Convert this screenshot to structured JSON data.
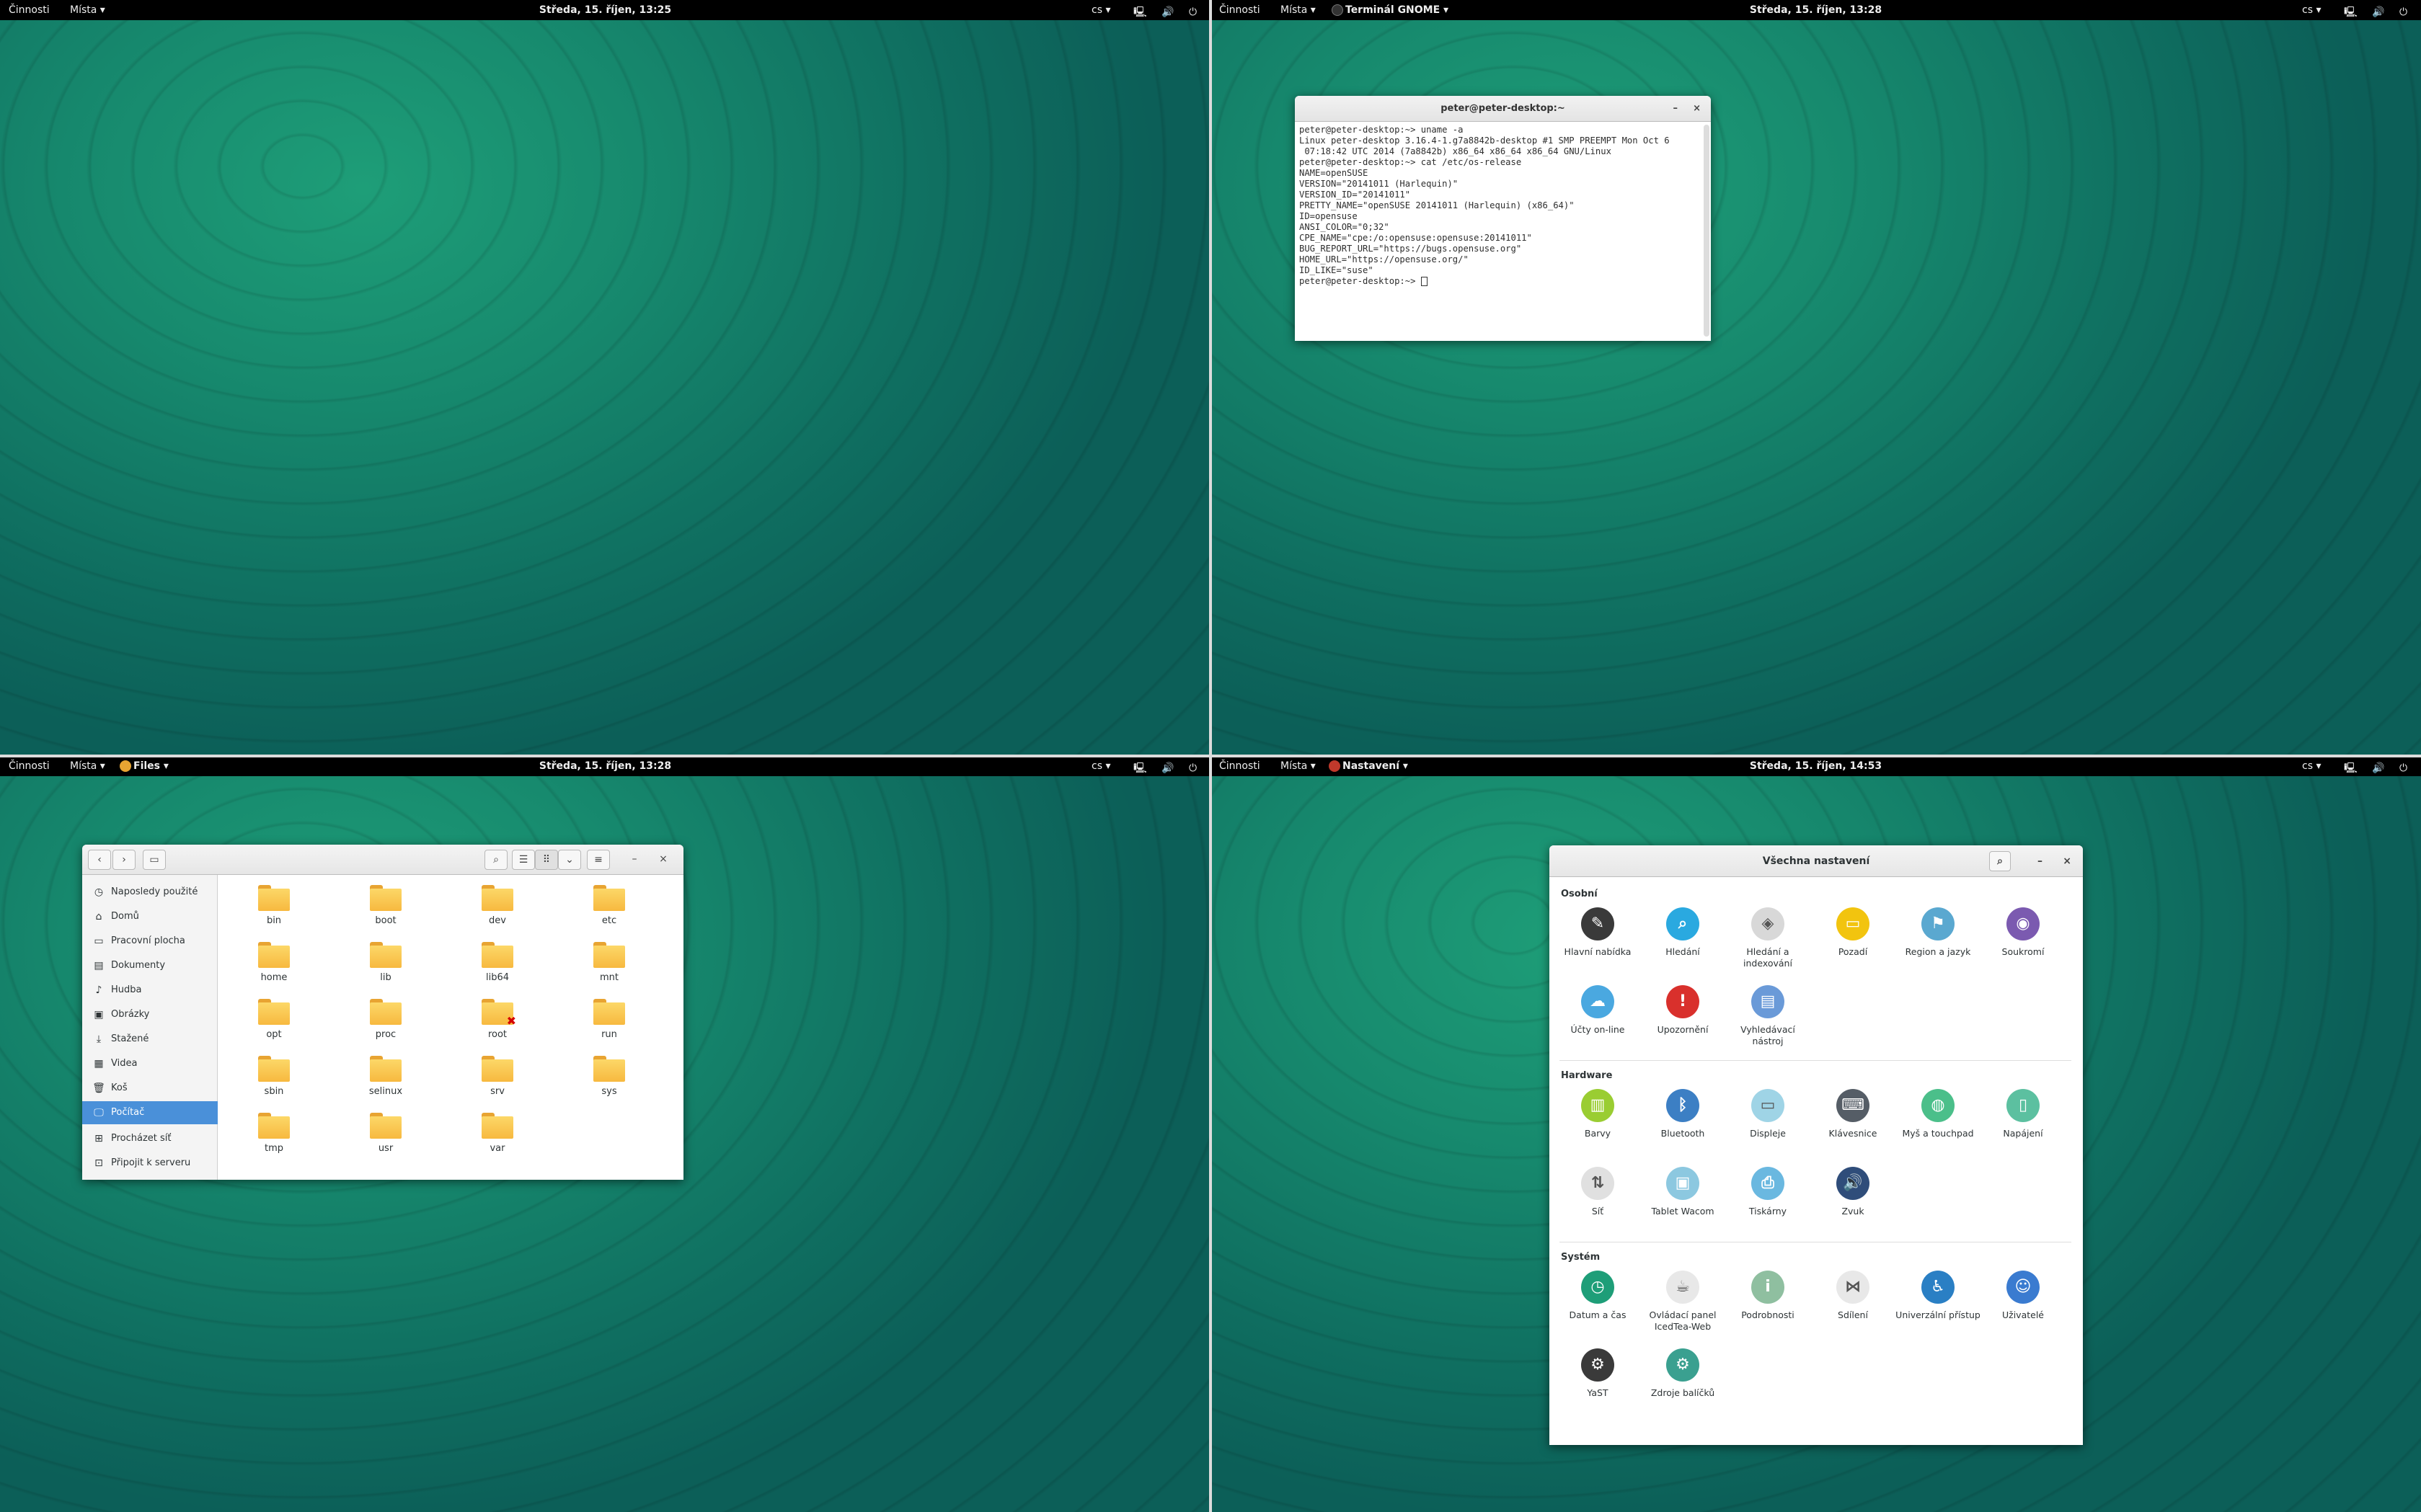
{
  "topbar_common": {
    "activities": "Činnosti",
    "places": "Místa ▾",
    "lang": "cs ▾",
    "sys_icons": "🖳 🔊 ⏻ ▾"
  },
  "q1": {
    "clock": "Středa, 15. říjen, 13:25"
  },
  "q2": {
    "clock": "Středa, 15. říjen, 13:28",
    "app": "Terminál GNOME ▾"
  },
  "q3": {
    "clock": "Středa, 15. říjen, 13:28",
    "app": "Files ▾"
  },
  "q4": {
    "clock": "Středa, 15. říjen, 14:53",
    "app": "Nastavení ▾"
  },
  "terminal": {
    "title": "peter@peter-desktop:~",
    "minimize": "–",
    "close": "×",
    "lines": [
      "peter@peter-desktop:~> uname -a",
      "Linux peter-desktop 3.16.4-1.g7a8842b-desktop #1 SMP PREEMPT Mon Oct 6",
      " 07:18:42 UTC 2014 (7a8842b) x86_64 x86_64 x86_64 GNU/Linux",
      "peter@peter-desktop:~> cat /etc/os-release",
      "NAME=openSUSE",
      "VERSION=\"20141011 (Harlequin)\"",
      "VERSION_ID=\"20141011\"",
      "PRETTY_NAME=\"openSUSE 20141011 (Harlequin) (x86_64)\"",
      "ID=opensuse",
      "ANSI_COLOR=\"0;32\"",
      "CPE_NAME=\"cpe:/o:opensuse:opensuse:20141011\"",
      "BUG_REPORT_URL=\"https://bugs.opensuse.org\"",
      "HOME_URL=\"https://opensuse.org/\"",
      "ID_LIKE=\"suse\""
    ],
    "prompt": "peter@peter-desktop:~> "
  },
  "files": {
    "back": "‹",
    "forward": "›",
    "location": "▭",
    "search": "⌕",
    "list_view": "☰",
    "grid_view": "⠿",
    "sort": "⌄",
    "menu": "≡",
    "minimize": "–",
    "close": "×",
    "sidebar": [
      {
        "label": "Naposledy použité",
        "icon": "◷"
      },
      {
        "label": "Domů",
        "icon": "⌂"
      },
      {
        "label": "Pracovní plocha",
        "icon": "▭"
      },
      {
        "label": "Dokumenty",
        "icon": "▤"
      },
      {
        "label": "Hudba",
        "icon": "♪"
      },
      {
        "label": "Obrázky",
        "icon": "▣"
      },
      {
        "label": "Stažené",
        "icon": "⤓"
      },
      {
        "label": "Videa",
        "icon": "▦"
      },
      {
        "label": "Koš",
        "icon": "🗑"
      },
      {
        "label": "Počítač",
        "icon": "🖵"
      },
      {
        "label": "Procházet síť",
        "icon": "⊞"
      },
      {
        "label": "Připojit k serveru",
        "icon": "⊡"
      }
    ],
    "folders": [
      "bin",
      "boot",
      "dev",
      "etc",
      "home",
      "lib",
      "lib64",
      "mnt",
      "opt",
      "proc",
      "root",
      "run",
      "sbin",
      "selinux",
      "srv",
      "sys",
      "tmp",
      "usr",
      "var"
    ]
  },
  "settings": {
    "title": "Všechna nastavení",
    "search": "⌕",
    "minimize": "–",
    "close": "×",
    "sections": [
      {
        "title": "Osobní",
        "items": [
          {
            "label": "Hlavní nabídka",
            "color": "#3a3a3a",
            "glyph": "✎"
          },
          {
            "label": "Hledání",
            "color": "#2aa9e0",
            "glyph": "⌕"
          },
          {
            "label": "Hledání a indexování",
            "color": "#d8d8d8",
            "glyph": "◈"
          },
          {
            "label": "Pozadí",
            "color": "#f2c40f",
            "glyph": "▭"
          },
          {
            "label": "Region a jazyk",
            "color": "#5aa8d0",
            "glyph": "⚑"
          },
          {
            "label": "Soukromí",
            "color": "#7b5ab0",
            "glyph": "◉"
          },
          {
            "label": "Účty on-line",
            "color": "#4aa8e0",
            "glyph": "☁"
          },
          {
            "label": "Upozornění",
            "color": "#d9302c",
            "glyph": "!"
          },
          {
            "label": "Vyhledávací nástroj",
            "color": "#6a9ad8",
            "glyph": "▤"
          }
        ]
      },
      {
        "title": "Hardware",
        "items": [
          {
            "label": "Barvy",
            "color": "#9acd32",
            "glyph": "▥"
          },
          {
            "label": "Bluetooth",
            "color": "#3c7fc4",
            "glyph": "ᛒ"
          },
          {
            "label": "Displeje",
            "color": "#9fd4e6",
            "glyph": "▭"
          },
          {
            "label": "Klávesnice",
            "color": "#555d66",
            "glyph": "⌨"
          },
          {
            "label": "Myš a touchpad",
            "color": "#4bbf8a",
            "glyph": "◍"
          },
          {
            "label": "Napájení",
            "color": "#5cc0a0",
            "glyph": "▯"
          },
          {
            "label": "Síť",
            "color": "#e0e0e0",
            "glyph": "⇅"
          },
          {
            "label": "Tablet Wacom",
            "color": "#8cc8e0",
            "glyph": "▣"
          },
          {
            "label": "Tiskárny",
            "color": "#6ab8e0",
            "glyph": "⎙"
          },
          {
            "label": "Zvuk",
            "color": "#2f4d7a",
            "glyph": "🔊"
          }
        ]
      },
      {
        "title": "Systém",
        "items": [
          {
            "label": "Datum a čas",
            "color": "#1e9e78",
            "glyph": "◷"
          },
          {
            "label": "Ovládací panel IcedTea-Web",
            "color": "#e8e8e8",
            "glyph": "☕"
          },
          {
            "label": "Podrobnosti",
            "color": "#8fbfa0",
            "glyph": "i"
          },
          {
            "label": "Sdílení",
            "color": "#e8e8e8",
            "glyph": "⋈"
          },
          {
            "label": "Univerzální přístup",
            "color": "#2a7fc4",
            "glyph": "♿"
          },
          {
            "label": "Uživatelé",
            "color": "#3a7bd0",
            "glyph": "☺"
          },
          {
            "label": "YaST",
            "color": "#3a3a3a",
            "glyph": "⚙"
          },
          {
            "label": "Zdroje balíčků",
            "color": "#3aa090",
            "glyph": "⚙"
          }
        ]
      }
    ]
  }
}
